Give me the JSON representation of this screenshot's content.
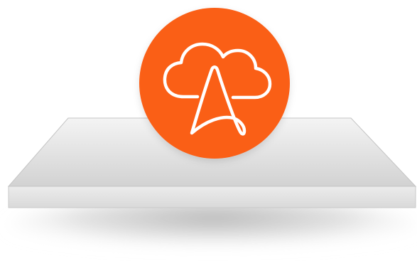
{
  "illustration": {
    "subject": "cloud-acrobat-logo-on-shelf",
    "icon": "cloud-with-acrobat-a-icon",
    "colors": {
      "badge": "#fa5e17",
      "icon_stroke": "#ffffff",
      "shelf_top_light": "#f2f2f2",
      "shelf_top_dark": "#cfcfcf",
      "shelf_edge": "#e1e1e1",
      "shadow": "#b4b4b4"
    }
  }
}
